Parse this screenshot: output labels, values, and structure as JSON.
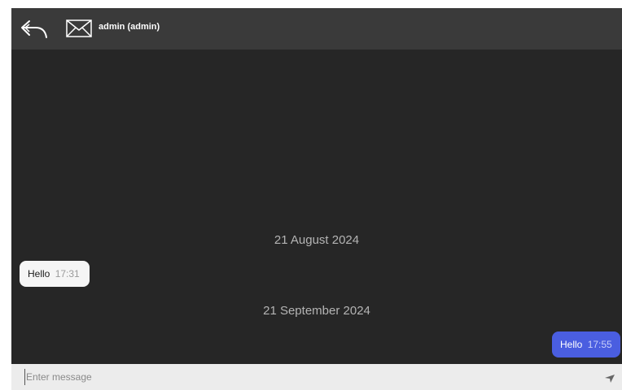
{
  "header": {
    "title": "admin (admin)",
    "back_icon": "back-arrow-icon",
    "mail_icon": "envelope-icon"
  },
  "messages": [
    {
      "type": "date",
      "text": "21 August 2024"
    },
    {
      "type": "incoming",
      "text": "Hello",
      "time": "17:31"
    },
    {
      "type": "date",
      "text": "21 September 2024"
    },
    {
      "type": "outgoing",
      "text": "Hello",
      "time": "17:55"
    }
  ],
  "composer": {
    "placeholder": "Enter message",
    "value": "",
    "send_icon": "send-icon"
  },
  "colors": {
    "background": "#262626",
    "header": "#3a3a3a",
    "incoming_bubble": "#f5f5f5",
    "outgoing_bubble": "#4a5ee0",
    "composer": "#ececec"
  }
}
